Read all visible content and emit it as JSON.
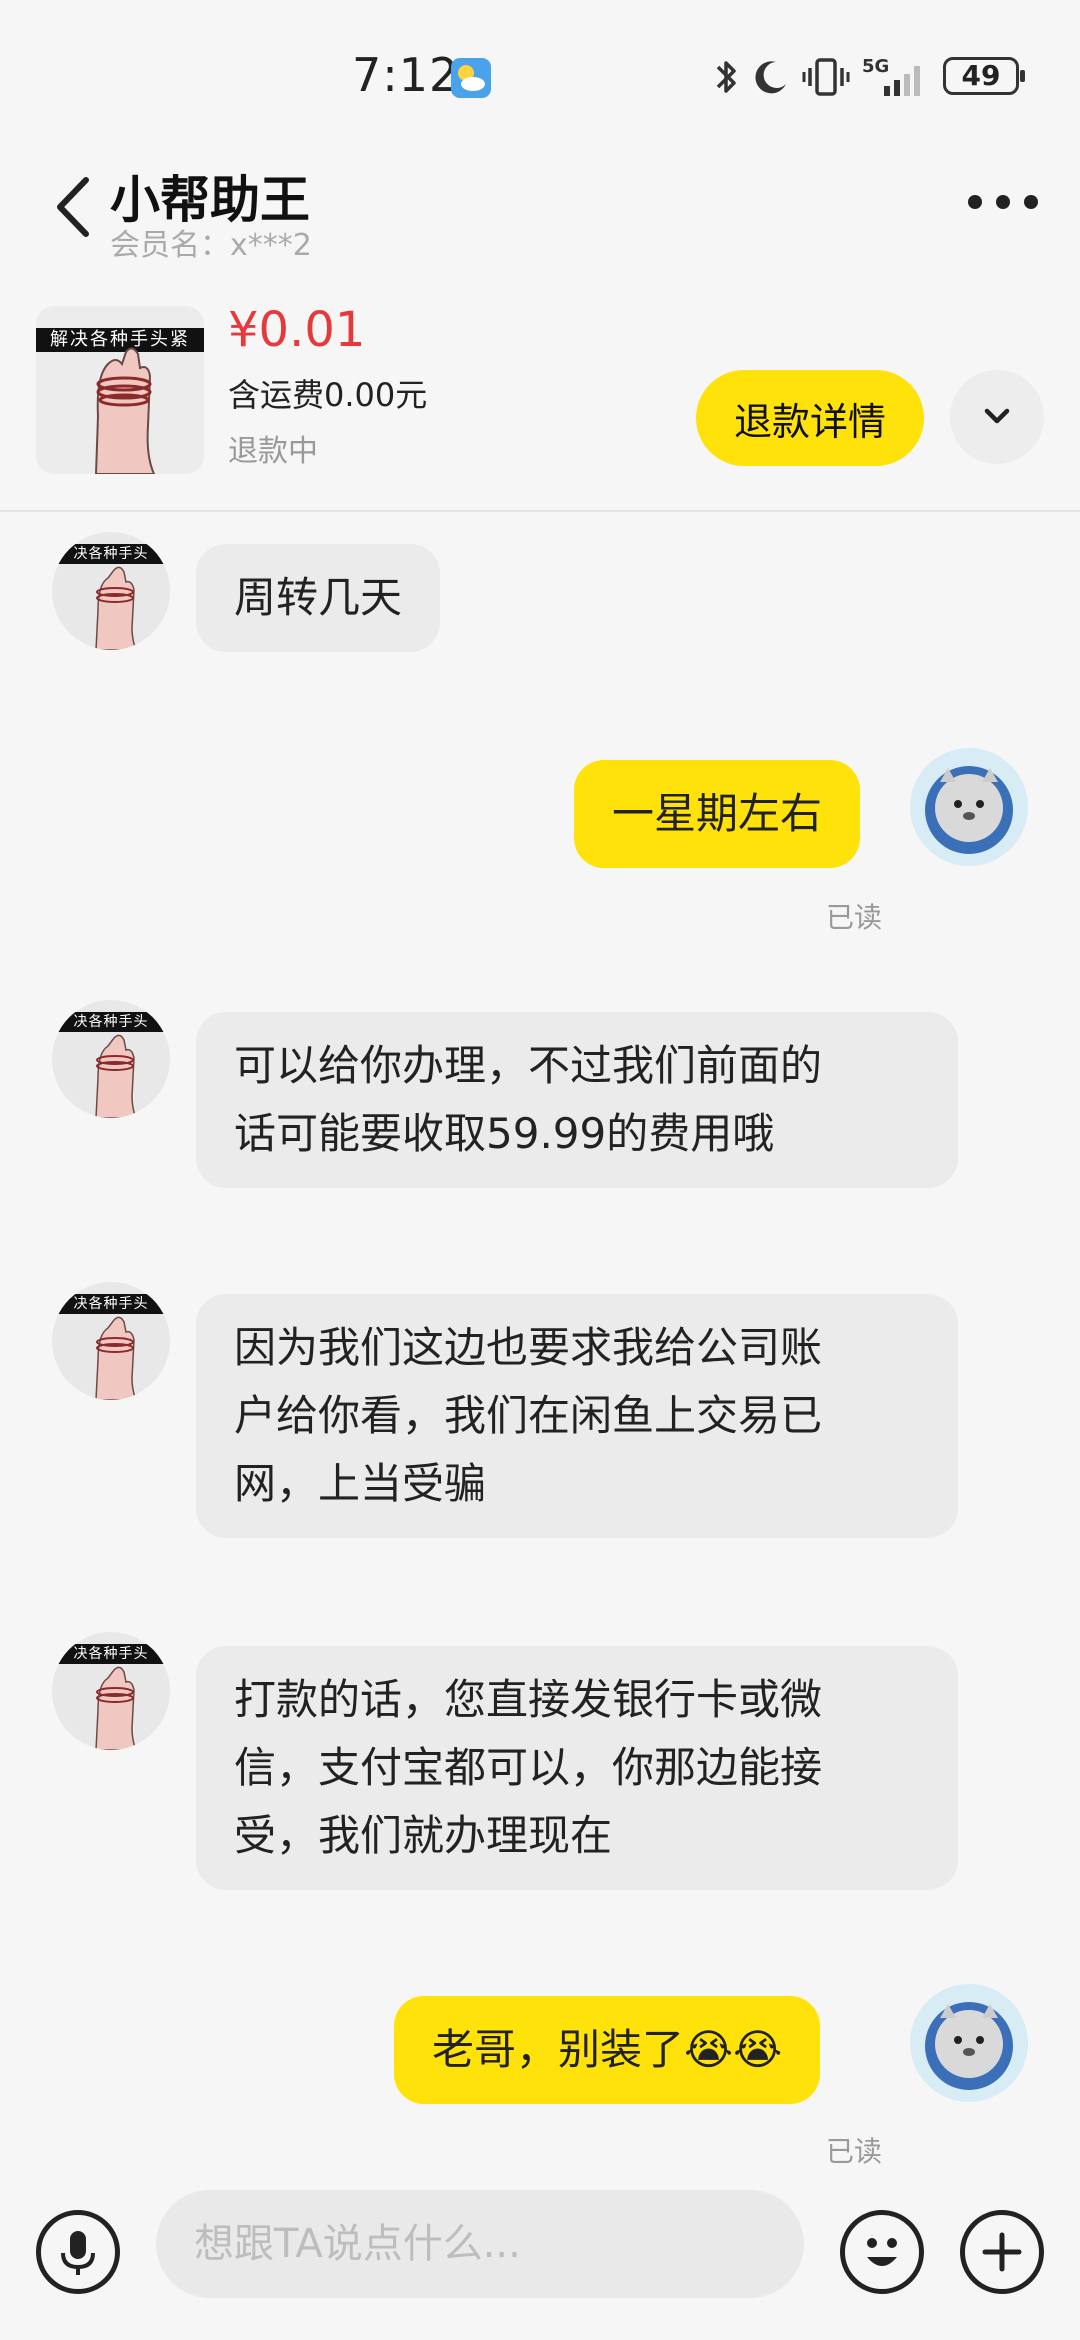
{
  "status_bar": {
    "time": "7:12",
    "network": "5G",
    "battery": "49",
    "icons": [
      "weather-icon",
      "bluetooth-icon",
      "moon-icon",
      "vibrate-icon",
      "signal-icon",
      "battery-icon"
    ]
  },
  "header": {
    "title": "小帮助王",
    "subtitle": "会员名：x***2",
    "icons": [
      "back-arrow-icon",
      "more-icon"
    ]
  },
  "product": {
    "thumb_banner": "解决各种手头紧",
    "price": "¥0.01",
    "shipping": "含运费0.00元",
    "status": "退款中",
    "refund_button": "退款详情",
    "icons": [
      "chevron-down-icon"
    ]
  },
  "chat": {
    "other_avatar_banner": "决各种手头",
    "messages": [
      {
        "sender": "other",
        "text": "周转几天"
      },
      {
        "sender": "me",
        "text": "一星期左右",
        "status": "已读"
      },
      {
        "sender": "other",
        "lines": [
          "可以给你办理，不过我们前面的",
          "话可能要收取59.99的费用哦"
        ]
      },
      {
        "sender": "other",
        "lines": [
          "因为我们这边也要求我给公司账",
          "户给你看，我们在闲鱼上交易已",
          "网，上当受骗"
        ]
      },
      {
        "sender": "other",
        "lines": [
          "打款的话，您直接发银行卡或微",
          "信，支付宝都可以，你那边能接",
          "受，我们就办理现在"
        ]
      },
      {
        "sender": "me",
        "text": "老哥，别装了😭😭",
        "status": "已读"
      }
    ]
  },
  "input_bar": {
    "placeholder": "想跟TA说点什么...",
    "icons": [
      "microphone-icon",
      "emoji-icon",
      "plus-icon"
    ]
  },
  "colors": {
    "accent_yellow": "#ffe20a",
    "price_red": "#e5393b",
    "bubble_grey": "#ebebeb",
    "background": "#f6f6f6"
  }
}
